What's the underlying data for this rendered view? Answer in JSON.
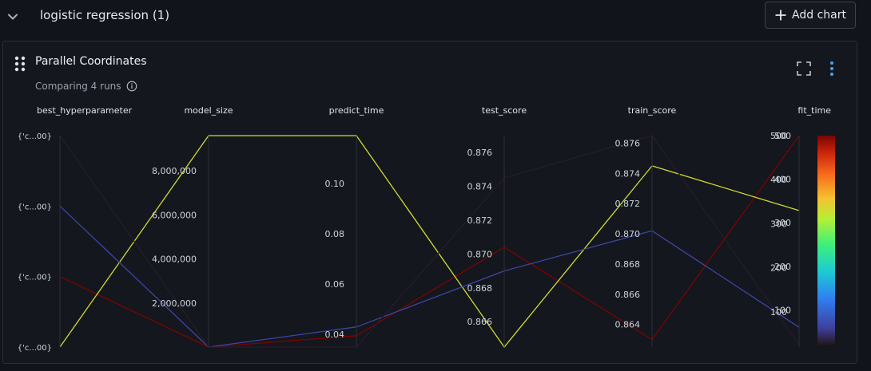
{
  "section": {
    "title": "logistic regression (1)",
    "add_chart_label": "Add chart"
  },
  "card": {
    "title": "Parallel Coordinates",
    "subtitle": "Comparing 4 runs"
  },
  "icons": {
    "collapse": "chevron-down-icon",
    "add": "plus-icon",
    "drag": "drag-handle-icon",
    "info": "info-icon",
    "fullscreen": "fullscreen-icon",
    "menu": "kebab-menu-icon"
  },
  "colors": {
    "background": "#11141a",
    "card": "#14171d",
    "menu_accent": "#4aa3f0"
  },
  "chart_data": {
    "type": "parallel_coordinates",
    "axes": [
      {
        "name": "best_hyperparameter",
        "kind": "categorical",
        "ticks": [
          "{'c...00}",
          "{'c...00}",
          "{'c...00}",
          "{'c...00}"
        ]
      },
      {
        "name": "model_size",
        "kind": "numeric",
        "range": [
          0,
          9600000
        ],
        "ticks": [
          2000000,
          4000000,
          6000000,
          8000000
        ],
        "tick_labels": [
          "2,000,000",
          "4,000,000",
          "6,000,000",
          "8,000,000"
        ]
      },
      {
        "name": "predict_time",
        "kind": "numeric",
        "range": [
          0.035,
          0.119
        ],
        "ticks": [
          0.04,
          0.06,
          0.08,
          0.1
        ],
        "tick_labels": [
          "0.04",
          "0.06",
          "0.08",
          "0.10"
        ]
      },
      {
        "name": "test_score",
        "kind": "numeric",
        "range": [
          0.8645,
          0.877
        ],
        "ticks": [
          0.866,
          0.868,
          0.87,
          0.872,
          0.874,
          0.876
        ],
        "tick_labels": [
          "0.866",
          "0.868",
          "0.870",
          "0.872",
          "0.874",
          "0.876"
        ]
      },
      {
        "name": "train_score",
        "kind": "numeric",
        "range": [
          0.8625,
          0.8765
        ],
        "ticks": [
          0.864,
          0.866,
          0.868,
          0.87,
          0.872,
          0.874,
          0.876
        ],
        "tick_labels": [
          "0.864",
          "0.866",
          "0.868",
          "0.870",
          "0.872",
          "0.874",
          "0.876"
        ]
      },
      {
        "name": "fit_time",
        "kind": "numeric",
        "range": [
          20,
          500
        ],
        "ticks": [
          100,
          200,
          300,
          400,
          500
        ],
        "tick_labels": [
          "100",
          "200",
          "300",
          "400",
          "500"
        ]
      }
    ],
    "runs": [
      {
        "values": [
          1,
          0,
          0.0395,
          0.8704,
          0.863,
          500
        ],
        "fit_time": 500
      },
      {
        "values": [
          0,
          9600000,
          0.119,
          0.8645,
          0.8745,
          330
        ],
        "fit_time": 330
      },
      {
        "values": [
          2,
          0,
          0.043,
          0.869,
          0.8702,
          65
        ],
        "fit_time": 65
      },
      {
        "values": [
          3,
          0,
          0.035,
          0.8745,
          0.8765,
          25
        ],
        "fit_time": 25
      }
    ],
    "colorbar": {
      "metric": "fit_time",
      "range": [
        20,
        500
      ],
      "ticks": [
        100,
        200,
        300,
        400,
        500
      ],
      "tick_labels": [
        "100",
        "200",
        "300",
        "400",
        "500"
      ]
    },
    "grid": false,
    "legend": "right"
  }
}
